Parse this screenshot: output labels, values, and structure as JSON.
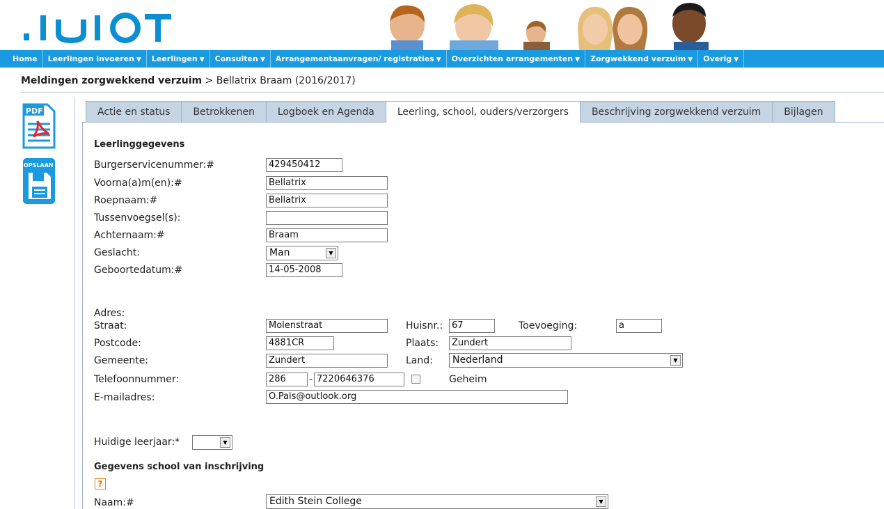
{
  "header": {
    "logo_text": "JUJOT"
  },
  "nav": {
    "items": [
      {
        "label": "Home",
        "dropdown": false
      },
      {
        "label": "Leerlingen invoeren",
        "dropdown": true
      },
      {
        "label": "Leerlingen",
        "dropdown": true
      },
      {
        "label": "Consulten",
        "dropdown": true
      },
      {
        "label": "Arrangementaanvragen/ registraties",
        "dropdown": true
      },
      {
        "label": "Overzichten arrangementen",
        "dropdown": true
      },
      {
        "label": "Zorgwekkend verzuim",
        "dropdown": true
      },
      {
        "label": "Overig",
        "dropdown": true
      }
    ],
    "caret": "▼"
  },
  "breadcrumb": {
    "section": "Meldingen zorgwekkend verzuim",
    "separator": ">",
    "current": "Bellatrix Braam (2016/2017)"
  },
  "sidebar": {
    "pdf_label": "PDF",
    "save_label": "OPSLAAN"
  },
  "tabs": [
    {
      "label": "Actie en status",
      "active": false
    },
    {
      "label": "Betrokkenen",
      "active": false
    },
    {
      "label": "Logboek en Agenda",
      "active": false
    },
    {
      "label": "Leerling, school, ouders/verzorgers",
      "active": true
    },
    {
      "label": "Beschrijving zorgwekkend verzuim",
      "active": false
    },
    {
      "label": "Bijlagen",
      "active": false
    }
  ],
  "form": {
    "leerling_title": "Leerlinggegevens",
    "bsn_label": "Burgerservicenummer:#",
    "bsn_value": "429450412",
    "voornamen_label": "Voorna(a)m(en):#",
    "voornamen_value": "Bellatrix",
    "roepnaam_label": "Roepnaam:#",
    "roepnaam_value": "Bellatrix",
    "tussenvoegsel_label": "Tussenvoegsel(s):",
    "tussenvoegsel_value": "",
    "achternaam_label": "Achternaam:#",
    "achternaam_value": "Braam",
    "geslacht_label": "Geslacht:",
    "geslacht_value": "Man",
    "geboortedatum_label": "Geboortedatum:#",
    "geboortedatum_value": "14-05-2008",
    "adres_label": "Adres:",
    "straat_label": "Straat:",
    "straat_value": "Molenstraat",
    "huisnr_label": "Huisnr.:",
    "huisnr_value": "67",
    "toevoeging_label": "Toevoeging:",
    "toevoeging_value": "a",
    "postcode_label": "Postcode:",
    "postcode_value": "4881CR",
    "plaats_label": "Plaats:",
    "plaats_value": "Zundert",
    "gemeente_label": "Gemeente:",
    "gemeente_value": "Zundert",
    "land_label": "Land:",
    "land_value": "Nederland",
    "telefoon_label": "Telefoonnummer:",
    "telefoon_prefix": "286",
    "telefoon_dash": "-",
    "telefoon_number": "7220646376",
    "geheim_label": "Geheim",
    "email_label": "E-mailadres:",
    "email_value": "O.Pais@outlook.org",
    "leerjaar_label": "Huidige leerjaar:*",
    "leerjaar_value": "",
    "school_title": "Gegevens school van inschrijving",
    "help_icon": "?",
    "naam_label": "Naam:#",
    "naam_value": "Edith Stein College"
  },
  "colors": {
    "nav_bg": "#1a9ae0",
    "logo": "#0c8ed3",
    "tab_bg": "#c6d5e4",
    "help": "#e37d1c"
  }
}
